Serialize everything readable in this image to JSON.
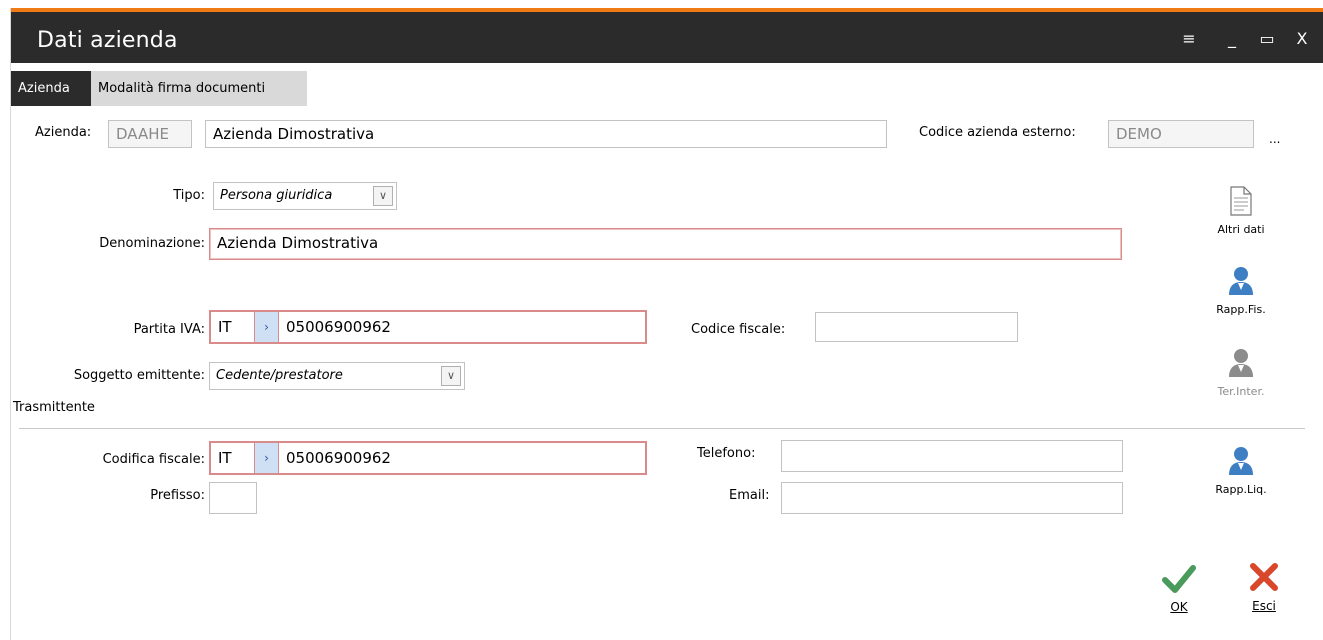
{
  "window": {
    "title": "Dati azienda",
    "controls": {
      "menu": "≡",
      "minimize": "_",
      "maximize": "▭",
      "close": "X"
    }
  },
  "tabs": [
    {
      "label": "Azienda",
      "active": true
    },
    {
      "label": "Modalità firma documenti",
      "active": false
    }
  ],
  "form": {
    "azienda_label": "Azienda:",
    "azienda_code": "DAAHE",
    "azienda_name": "Azienda Dimostrativa",
    "codice_esterno_label": "Codice azienda esterno:",
    "codice_esterno": "DEMO",
    "ellipsis": "...",
    "tipo_label": "Tipo:",
    "tipo_value": "Persona giuridica",
    "denominazione_label": "Denominazione:",
    "denominazione_value": "Azienda Dimostrativa",
    "partita_iva_label": "Partita IVA:",
    "partita_iva_country": "IT",
    "partita_iva_number": "05006900962",
    "codice_fiscale_label": "Codice fiscale:",
    "codice_fiscale_value": "",
    "soggetto_label": "Soggetto emittente:",
    "soggetto_value": "Cedente/prestatore",
    "trasmittente_label": "Trasmittente",
    "codifica_label": "Codifica fiscale:",
    "codifica_country": "IT",
    "codifica_number": "05006900962",
    "telefono_label": "Telefono:",
    "telefono_value": "",
    "prefisso_label": "Prefisso:",
    "prefisso_value": "",
    "email_label": "Email:",
    "email_value": ""
  },
  "side_buttons": {
    "altri_dati": "Altri dati",
    "rapp_fis": "Rapp.Fis.",
    "ter_inter": "Ter.Inter.",
    "rapp_liq": "Rapp.Liq."
  },
  "actions": {
    "ok": "OK",
    "esci": "Esci"
  },
  "colors": {
    "titlebar": "#2b2b2b",
    "accent_top": "#f07a14",
    "required_border": "#d98a8a",
    "person_icon": "#3e7ec3",
    "ok_green": "#4a9a5c",
    "esci_red": "#d9472b"
  }
}
